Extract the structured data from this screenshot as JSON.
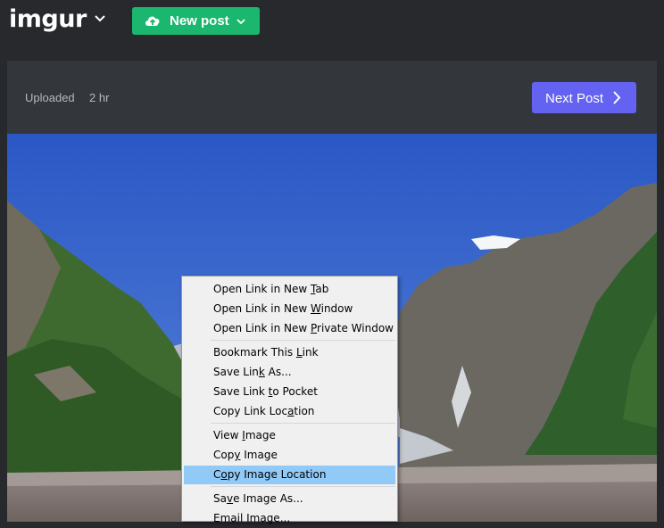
{
  "header": {
    "logo": "imgur",
    "new_post_label": "New post"
  },
  "post": {
    "uploaded_label": "Uploaded",
    "uploaded_time": "2 hr",
    "next_post_label": "Next Post"
  },
  "context_menu": {
    "items": [
      {
        "pre": "Open Link in New ",
        "key": "T",
        "post": "ab"
      },
      {
        "pre": "Open Link in New ",
        "key": "W",
        "post": "indow"
      },
      {
        "pre": "Open Link in New ",
        "key": "P",
        "post": "rivate Window"
      },
      {
        "pre": "Bookmark This ",
        "key": "L",
        "post": "ink"
      },
      {
        "pre": "Save Lin",
        "key": "k",
        "post": " As..."
      },
      {
        "pre": "Save Link ",
        "key": "t",
        "post": "o Pocket"
      },
      {
        "pre": "Copy Link Loc",
        "key": "a",
        "post": "tion"
      },
      {
        "pre": "View ",
        "key": "I",
        "post": "mage"
      },
      {
        "pre": "Cop",
        "key": "y",
        "post": " Image"
      },
      {
        "pre": "C",
        "key": "o",
        "post": "py Image Location"
      },
      {
        "pre": "Sa",
        "key": "v",
        "post": "e Image As..."
      },
      {
        "pre": "",
        "key": "",
        "post": "Email Image..."
      }
    ]
  },
  "colors": {
    "background": "#27292d",
    "panel": "#33363b",
    "new_post_green": "#1bb76e",
    "next_post_purple": "#6362f1",
    "menu_highlight": "#91c9f7"
  },
  "icons": {
    "new_post": "cloud-upload-icon",
    "dropdown": "chevron-down-icon",
    "next": "chevron-right-icon"
  }
}
